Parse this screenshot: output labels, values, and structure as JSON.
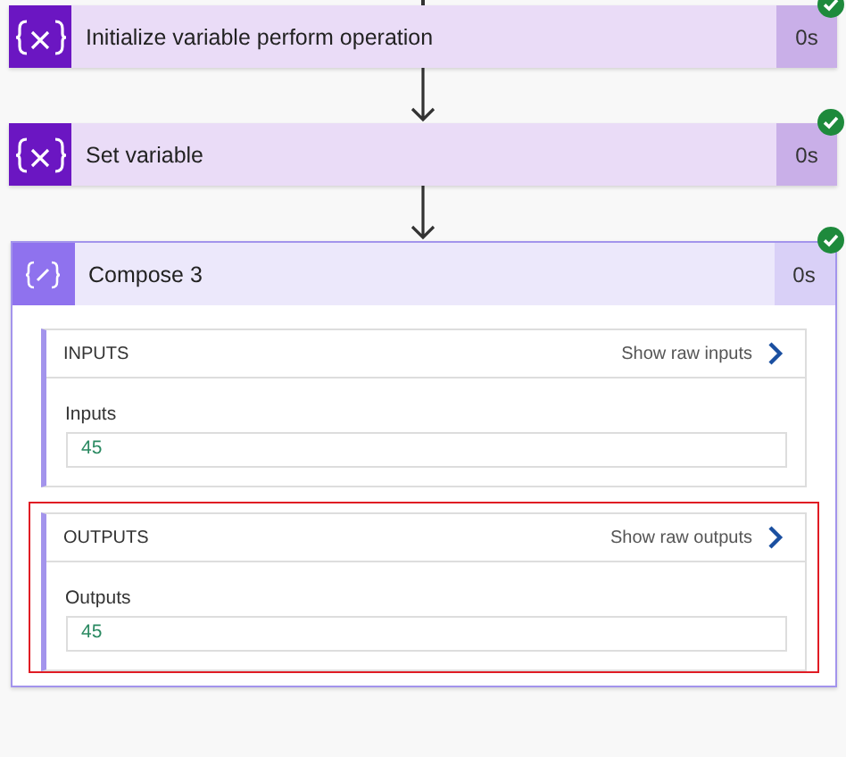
{
  "steps": [
    {
      "kind": "variable",
      "title": "Initialize variable perform operation",
      "duration": "0s",
      "succeeded": true
    },
    {
      "kind": "variable",
      "title": "Set variable",
      "duration": "0s",
      "succeeded": true
    },
    {
      "kind": "compose",
      "title": "Compose 3",
      "duration": "0s",
      "succeeded": true,
      "expanded": true,
      "sections": [
        {
          "heading": "INPUTS",
          "link": "Show raw inputs",
          "label": "Inputs",
          "value": "45",
          "highlighted": false
        },
        {
          "heading": "OUTPUTS",
          "link": "Show raw outputs",
          "label": "Outputs",
          "value": "45",
          "highlighted": true
        }
      ]
    }
  ]
}
